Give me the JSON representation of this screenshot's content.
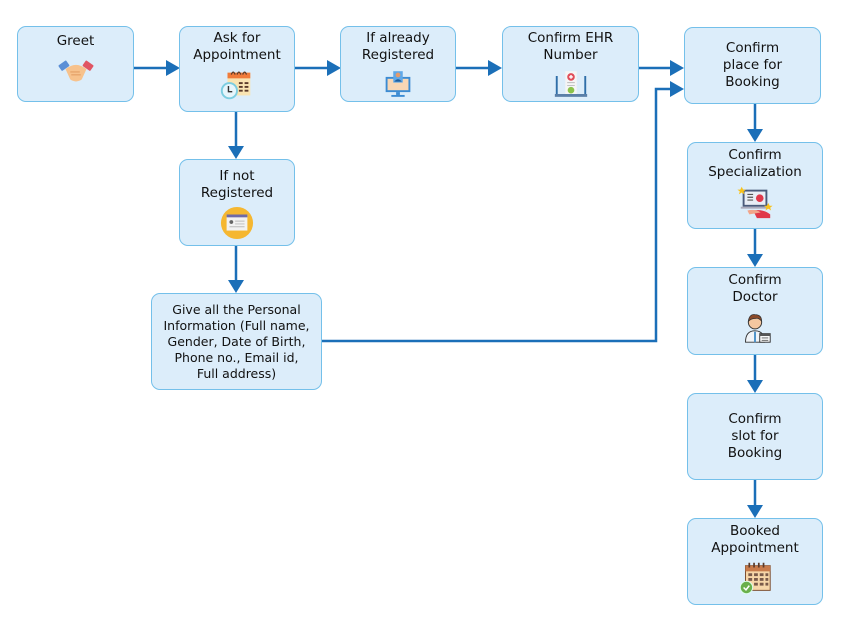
{
  "diagram": {
    "nodes": [
      {
        "id": "greet",
        "label": "Greet",
        "icon": "handshake-icon"
      },
      {
        "id": "ask-appointment",
        "label": "Ask for\nAppointment",
        "icon": "calendar-clock-icon"
      },
      {
        "id": "already-registered",
        "label": "If already\nRegistered",
        "icon": "computer-user-icon"
      },
      {
        "id": "confirm-ehr",
        "label": "Confirm EHR\nNumber",
        "icon": "medical-record-icon"
      },
      {
        "id": "confirm-place",
        "label": "Confirm\nplace for\nBooking",
        "icon": ""
      },
      {
        "id": "not-registered",
        "label": "If not\nRegistered",
        "icon": "registration-form-icon"
      },
      {
        "id": "personal-info",
        "label": "Give all the Personal\nInformation (Full name,\nGender, Date of Birth,\nPhone no., Email id,\nFull address)",
        "icon": ""
      },
      {
        "id": "confirm-specialization",
        "label": "Confirm\nSpecialization",
        "icon": "laptop-presentation-icon"
      },
      {
        "id": "confirm-doctor",
        "label": "Confirm\nDoctor",
        "icon": "doctor-icon"
      },
      {
        "id": "confirm-slot",
        "label": "Confirm\nslot for\nBooking",
        "icon": ""
      },
      {
        "id": "booked",
        "label": "Booked\nAppointment",
        "icon": "calendar-check-icon"
      }
    ],
    "edges": [
      {
        "from": "greet",
        "to": "ask-appointment"
      },
      {
        "from": "ask-appointment",
        "to": "already-registered"
      },
      {
        "from": "already-registered",
        "to": "confirm-ehr"
      },
      {
        "from": "confirm-ehr",
        "to": "confirm-place"
      },
      {
        "from": "ask-appointment",
        "to": "not-registered"
      },
      {
        "from": "not-registered",
        "to": "personal-info"
      },
      {
        "from": "personal-info",
        "to": "confirm-place"
      },
      {
        "from": "confirm-place",
        "to": "confirm-specialization"
      },
      {
        "from": "confirm-specialization",
        "to": "confirm-doctor"
      },
      {
        "from": "confirm-doctor",
        "to": "confirm-slot"
      },
      {
        "from": "confirm-slot",
        "to": "booked"
      }
    ],
    "colors": {
      "node_fill": "#dcedfa",
      "node_border": "#74c0ea",
      "arrow": "#1b6fb8",
      "text": "#111111"
    }
  }
}
